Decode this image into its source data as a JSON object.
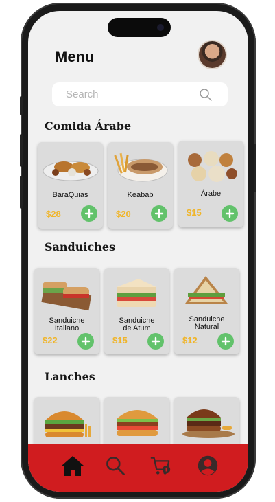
{
  "header": {
    "title": "Menu"
  },
  "search": {
    "placeholder": "Search"
  },
  "sections": [
    {
      "title": "Comida Árabe",
      "items": [
        {
          "name": "BaraQuias",
          "price": "$28"
        },
        {
          "name": "Keabab",
          "price": "$20"
        },
        {
          "name": "Árabe",
          "price": "$15"
        }
      ]
    },
    {
      "title": "Sanduiches",
      "items": [
        {
          "name_line1": "Sanduiche",
          "name_line2": "Italiano",
          "price": "$22"
        },
        {
          "name_line1": "Sanduiche",
          "name_line2": "de Atum",
          "price": "$15"
        },
        {
          "name_line1": "Sanduiche",
          "name_line2": "Natural",
          "price": "$12"
        }
      ]
    },
    {
      "title": "Lanches",
      "items": [
        {},
        {},
        {}
      ]
    }
  ],
  "bottom_nav": {
    "items": [
      {
        "icon": "home-icon"
      },
      {
        "icon": "search-icon"
      },
      {
        "icon": "cart-icon"
      },
      {
        "icon": "profile-icon"
      }
    ],
    "background": "#d01c1f"
  },
  "colors": {
    "price": "#f0b529",
    "add_button": "#62c26b",
    "accent": "#d01c1f"
  }
}
